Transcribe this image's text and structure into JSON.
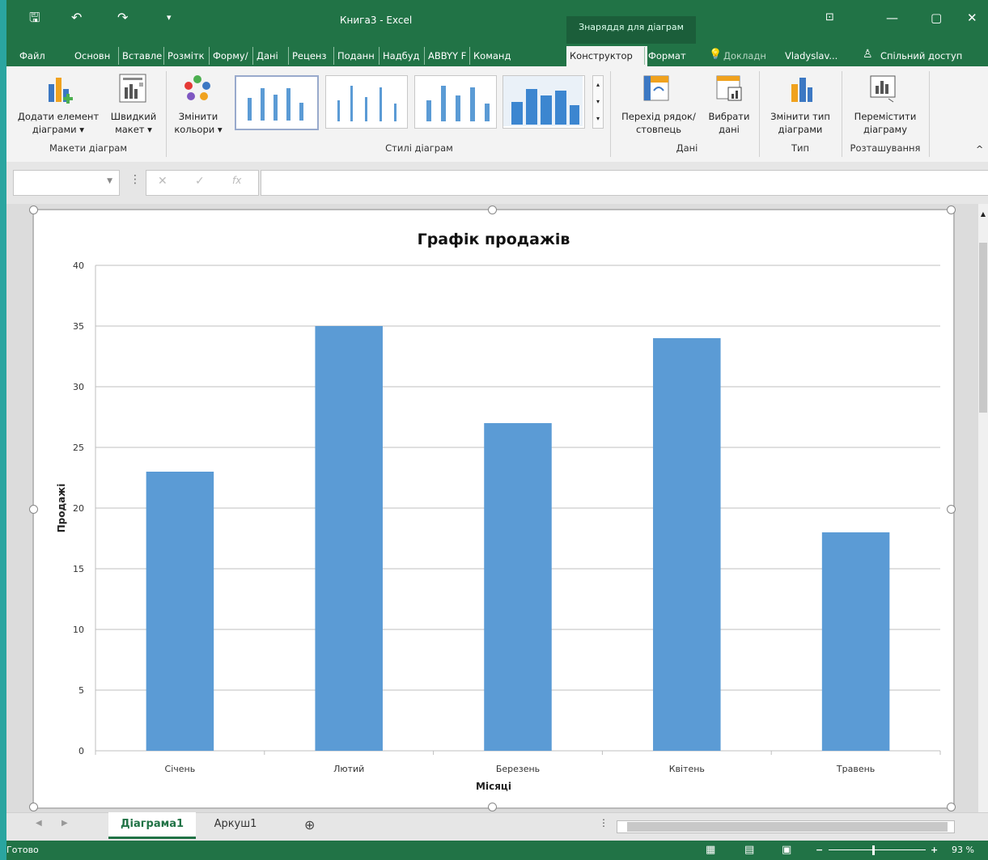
{
  "window": {
    "title": "Книга3 - Excel",
    "context_tools": "Знаряддя для діаграм",
    "accent": "#217346"
  },
  "tabs": [
    "Файл",
    "Основн",
    "Вставле",
    "Розмітк",
    "Форму/",
    "Дані",
    "Реценз",
    "Поданн",
    "Надбуд",
    "ABBYY F",
    "Команд",
    "Конструктор",
    "Формат",
    "Докладн",
    "Vladyslav...",
    "Спільний доступ"
  ],
  "ribbon": {
    "add_element": [
      "Додати елемент",
      "діаграми ▾"
    ],
    "quick_layout": [
      "Швидкий",
      "макет ▾"
    ],
    "change_colors": [
      "Змінити",
      "кольори ▾"
    ],
    "switch_rowcol": [
      "Перехід рядок/",
      "стовпець"
    ],
    "select_data": [
      "Вибрати",
      "дані"
    ],
    "change_type": [
      "Змінити тип",
      "діаграми"
    ],
    "move_chart": [
      "Перемістити",
      "діаграму"
    ],
    "groups": {
      "layouts": "Макети діаграм",
      "styles": "Стилі діаграм",
      "data": "Дані",
      "type": "Тип",
      "location": "Розташування"
    }
  },
  "formula_bar": {
    "fx": "fx",
    "cancel": "✕",
    "enter": "✓"
  },
  "chart_data": {
    "type": "bar",
    "title": "Графік продажів",
    "xlabel": "Місяці",
    "ylabel": "Продажі",
    "categories": [
      "Січень",
      "Лютий",
      "Березень",
      "Квітень",
      "Травень"
    ],
    "values": [
      23,
      35,
      27,
      34,
      18
    ],
    "ylim": [
      0,
      40
    ],
    "yticks": [
      0,
      5,
      10,
      15,
      20,
      25,
      30,
      35,
      40
    ],
    "grid": true,
    "bar_color": "#5b9bd5"
  },
  "sheets": {
    "active": "Діаграма1",
    "other": "Аркуш1"
  },
  "status": {
    "ready": "Готово",
    "zoom": "93 %"
  }
}
